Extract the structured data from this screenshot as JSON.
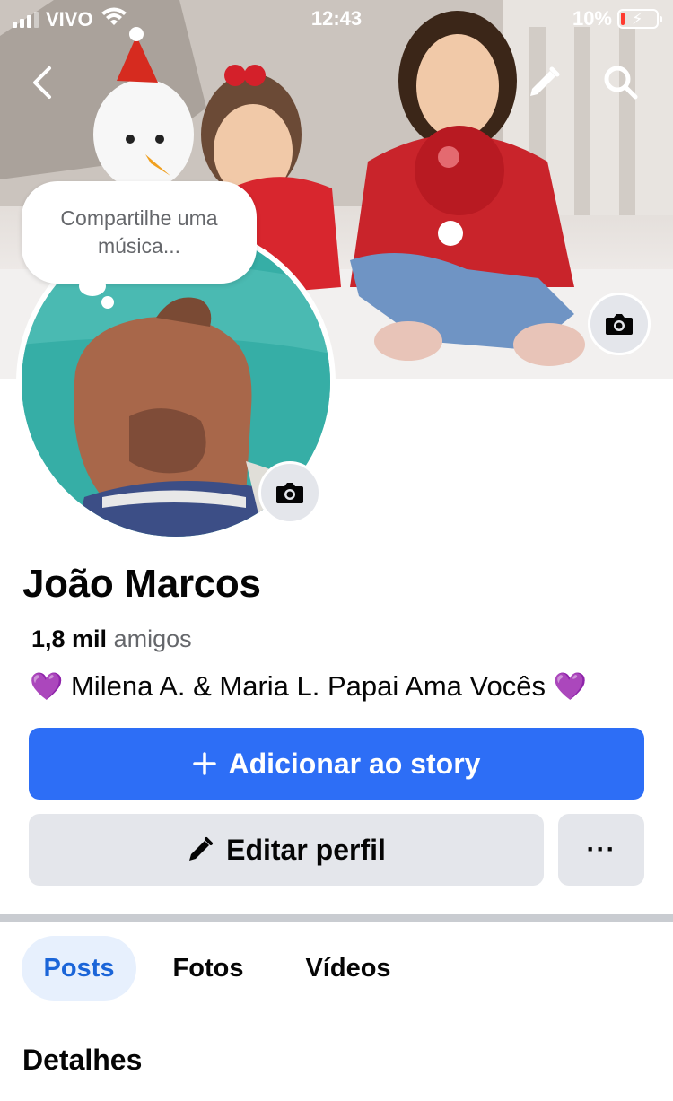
{
  "status_bar": {
    "carrier": "VIVO",
    "time": "12:43",
    "battery_percent": "10%",
    "battery_level": 0.1
  },
  "nav": {
    "back_icon": "chevron-left-icon",
    "edit_icon": "pencil-icon",
    "search_icon": "search-icon"
  },
  "bubble": {
    "text": "Compartilhe uma música..."
  },
  "profile": {
    "name": "João Marcos",
    "friends_count": "1,8 mil",
    "friends_label": "amigos",
    "bio_heart_left": "💜",
    "bio_text": "Milena A. & Maria L. Papai Ama Vocês",
    "bio_heart_right": "💜"
  },
  "actions": {
    "add_story_label": "Adicionar ao story",
    "edit_profile_label": "Editar perfil",
    "more_label": "···"
  },
  "tabs": [
    {
      "label": "Posts",
      "active": true
    },
    {
      "label": "Fotos",
      "active": false
    },
    {
      "label": "Vídeos",
      "active": false
    }
  ],
  "details": {
    "title": "Detalhes"
  },
  "colors": {
    "primary_blue": "#2d6ef6",
    "active_tab_bg": "#e7f0fd",
    "active_tab_text": "#1b65d8",
    "secondary_button": "#e4e6eb",
    "muted_text": "#65676b"
  }
}
